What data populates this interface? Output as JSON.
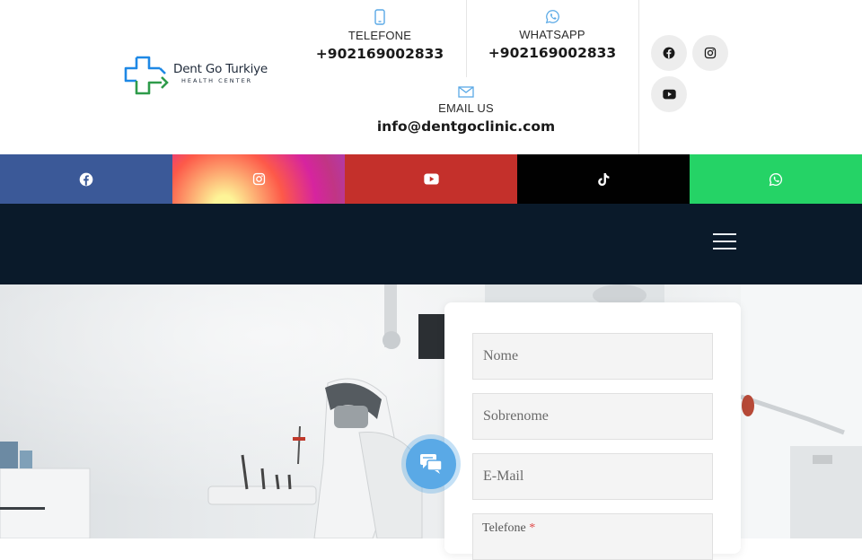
{
  "brand": {
    "name": "Dent Go Turkiye",
    "tagline": "HEALTH CENTER",
    "colors": {
      "blue": "#1e88e5",
      "green": "#2e9b4a"
    }
  },
  "contacts": {
    "phone": {
      "label": "TELEFONE",
      "value": "+902169002833",
      "icon": "mobile-phone-icon"
    },
    "whatsapp": {
      "label": "WHATSAPP",
      "value": "+902169002833",
      "icon": "whatsapp-icon"
    },
    "email": {
      "label": "EMAIL US",
      "value": "info@dentgoclinic.com",
      "icon": "envelope-icon"
    }
  },
  "header_social": [
    "facebook-icon",
    "instagram-icon",
    "youtube-icon"
  ],
  "social_bar": [
    {
      "name": "facebook",
      "color": "#3b5998",
      "icon": "facebook-icon"
    },
    {
      "name": "instagram",
      "color": "gradient",
      "icon": "instagram-icon"
    },
    {
      "name": "youtube",
      "color": "#c4302b",
      "icon": "youtube-icon"
    },
    {
      "name": "tiktok",
      "color": "#010101",
      "icon": "tiktok-icon"
    },
    {
      "name": "whatsapp",
      "color": "#25d366",
      "icon": "whatsapp-icon"
    }
  ],
  "nav": {
    "background": "#0a1a2a",
    "menu_icon": "hamburger-menu-icon"
  },
  "form": {
    "nome_placeholder": "Nome",
    "sobrenome_placeholder": "Sobrenome",
    "email_placeholder": "E-Mail",
    "telefone_label": "Telefone",
    "required_mark": "*"
  },
  "chat": {
    "icon": "chat-bubbles-icon",
    "color": "#5aa9e6"
  }
}
